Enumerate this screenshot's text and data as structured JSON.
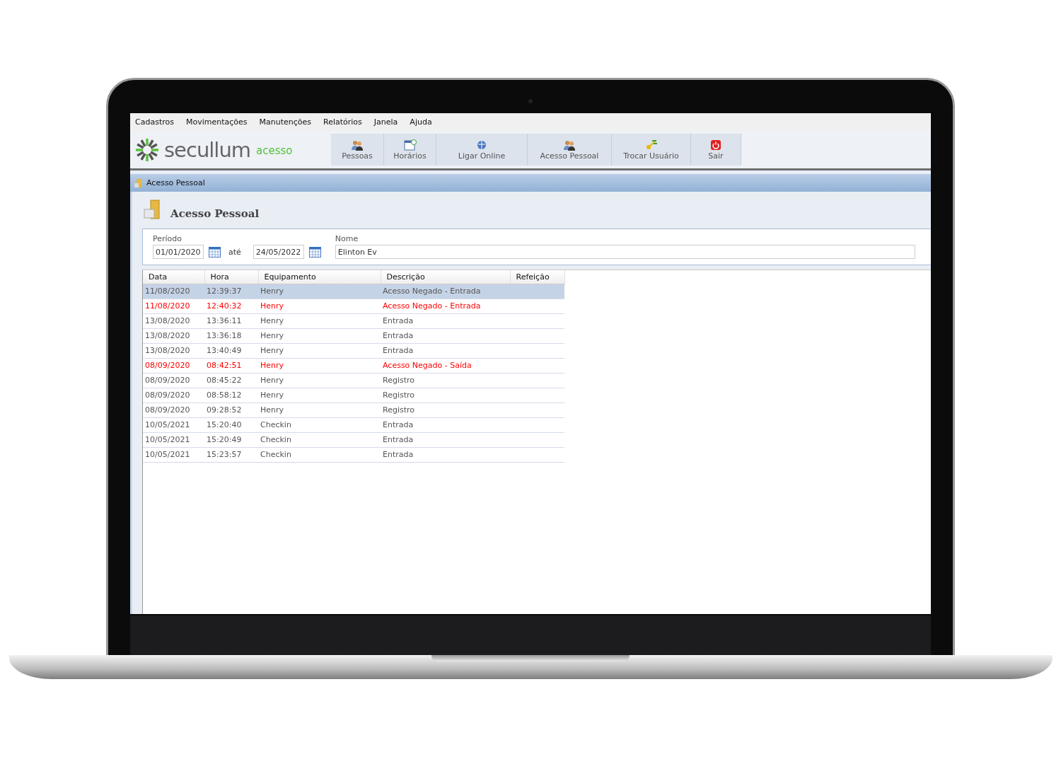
{
  "menu": [
    {
      "label": "Cadastros"
    },
    {
      "label": "Movimentações"
    },
    {
      "label": "Manutenções"
    },
    {
      "label": "Relatórios"
    },
    {
      "label": "Janela"
    },
    {
      "label": "Ajuda"
    }
  ],
  "logo": {
    "name": "secullum",
    "product": "acesso"
  },
  "toolbar": [
    {
      "label": "Pessoas",
      "kind": "people"
    },
    {
      "label": "Horários",
      "kind": "calendar"
    },
    {
      "label": "Ligar Online",
      "kind": "globe"
    },
    {
      "label": "Acesso Pessoal",
      "kind": "people"
    },
    {
      "label": "Trocar Usuário",
      "kind": "swap"
    },
    {
      "label": "Sair",
      "kind": "power"
    }
  ],
  "window": {
    "title": "Acesso Pessoal",
    "heading": "Acesso Pessoal"
  },
  "filters": {
    "period_label": "Período",
    "start": "01/01/2020",
    "separator": "até",
    "end": "24/05/2022",
    "name_label": "Nome",
    "name": "Elinton Ev"
  },
  "table": {
    "columns": [
      "Data",
      "Hora",
      "Equipamento",
      "Descrição",
      "Refeição"
    ],
    "rows": [
      {
        "cells": [
          "11/08/2020",
          "12:39:37",
          "Henry",
          "Acesso Negado - Entrada"
        ],
        "selected": true,
        "color": "#555555"
      },
      {
        "cells": [
          "11/08/2020",
          "12:40:32",
          "Henry",
          "Acesso Negado - Entrada"
        ],
        "selected": false,
        "color": "#ff0000"
      },
      {
        "cells": [
          "13/08/2020",
          "13:36:11",
          "Henry",
          "Entrada"
        ],
        "selected": false,
        "color": "#555555"
      },
      {
        "cells": [
          "13/08/2020",
          "13:36:18",
          "Henry",
          "Entrada"
        ],
        "selected": false,
        "color": "#555555"
      },
      {
        "cells": [
          "13/08/2020",
          "13:40:49",
          "Henry",
          "Entrada"
        ],
        "selected": false,
        "color": "#555555"
      },
      {
        "cells": [
          "08/09/2020",
          "08:42:51",
          "Henry",
          "Acesso Negado - Saída"
        ],
        "selected": false,
        "color": "#ff0000"
      },
      {
        "cells": [
          "08/09/2020",
          "08:45:22",
          "Henry",
          "Registro"
        ],
        "selected": false,
        "color": "#555555"
      },
      {
        "cells": [
          "08/09/2020",
          "08:58:12",
          "Henry",
          "Registro"
        ],
        "selected": false,
        "color": "#555555"
      },
      {
        "cells": [
          "08/09/2020",
          "09:28:52",
          "Henry",
          "Registro"
        ],
        "selected": false,
        "color": "#555555"
      },
      {
        "cells": [
          "10/05/2021",
          "15:20:40",
          "Checkin",
          "Entrada"
        ],
        "selected": false,
        "color": "#555555"
      },
      {
        "cells": [
          "10/05/2021",
          "15:20:49",
          "Checkin",
          "Entrada"
        ],
        "selected": false,
        "color": "#555555"
      },
      {
        "cells": [
          "10/05/2021",
          "15:23:57",
          "Checkin",
          "Entrada"
        ],
        "selected": false,
        "color": "#555555"
      }
    ]
  }
}
